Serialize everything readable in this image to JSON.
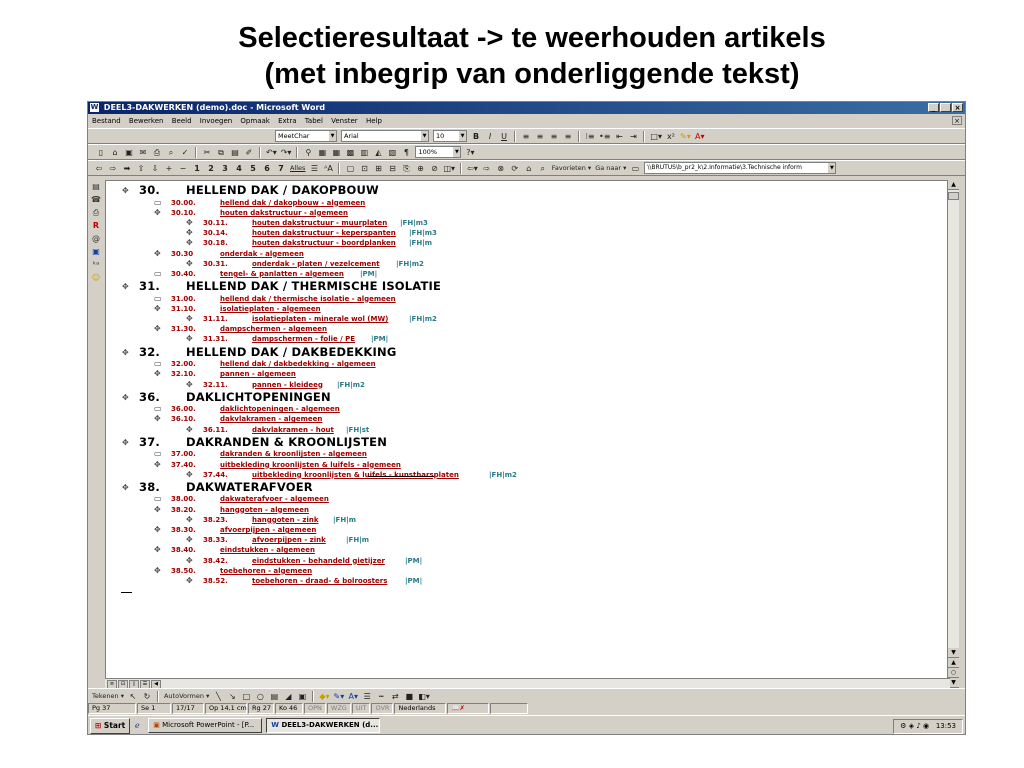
{
  "slide": {
    "title_line1": "Selectieresultaat -> te weerhouden artikels",
    "title_line2": "(met inbegrip van onderliggende tekst)"
  },
  "window": {
    "title": "DEEL3-DAKWERKEN (demo).doc - Microsoft Word",
    "minimize": "_",
    "restore": " ",
    "close": "×"
  },
  "menu": {
    "items": [
      "Bestand",
      "Bewerken",
      "Beeld",
      "Invoegen",
      "Opmaak",
      "Extra",
      "Tabel",
      "Venster",
      "Help"
    ],
    "doc_close": "×"
  },
  "format_toolbar": {
    "style": "MeetChar",
    "font": "Arial",
    "size": "10"
  },
  "standard_toolbar": {
    "zoom": "100%"
  },
  "outline_toolbar": {
    "levels": [
      "1",
      "2",
      "3",
      "4",
      "5",
      "6",
      "7"
    ],
    "all_label": "Alles",
    "favorites": "Favorieten",
    "goto": "Ga naar",
    "address": "\\\\BRUTUS\\b_pr2_k\\2.Informatie\\3.Technische inform"
  },
  "outline": [
    {
      "level": 1,
      "num": "30.",
      "text": "HELLEND DAK / DAKOPBOUW"
    },
    {
      "level": 2,
      "num": "30.00.",
      "text": "hellend dak / dakopbouw - algemeen"
    },
    {
      "level": 2,
      "num": "30.10.",
      "text": "houten dakstructuur - algemeen"
    },
    {
      "level": 3,
      "num": "30.11.",
      "text": "houten dakstructuur - muurplaten",
      "code": "|FH|m3"
    },
    {
      "level": 3,
      "num": "30.14.",
      "text": "houten dakstructuur - keperspanten",
      "code": "|FH|m3"
    },
    {
      "level": 3,
      "num": "30.18.",
      "text": "houten dakstructuur - boordplanken",
      "code": "|FH|m"
    },
    {
      "level": 2,
      "num": "30.30",
      "text": "onderdak - algemeen"
    },
    {
      "level": 3,
      "num": "30.31.",
      "text": "onderdak - platen / vezelcement",
      "code": "|FH|m2"
    },
    {
      "level": 2,
      "num": "30.40.",
      "text": "tengel- & panlatten - algemeen",
      "code": "|PM|"
    },
    {
      "level": 1,
      "num": "31.",
      "text": "HELLEND DAK / THERMISCHE ISOLATIE"
    },
    {
      "level": 2,
      "num": "31.00.",
      "text": "hellend dak / thermische isolatie - algemeen"
    },
    {
      "level": 2,
      "num": "31.10.",
      "text": "isolatieplaten - algemeen"
    },
    {
      "level": 3,
      "num": "31.11.",
      "text": "isolatieplaten - minerale wol (MW)",
      "code": "|FH|m2"
    },
    {
      "level": 2,
      "num": "31.30.",
      "text": "dampschermen - algemeen"
    },
    {
      "level": 3,
      "num": "31.31.",
      "text": "dampschermen - folie / PE",
      "code": "|PM|"
    },
    {
      "level": 1,
      "num": "32.",
      "text": "HELLEND DAK / DAKBEDEKKING"
    },
    {
      "level": 2,
      "num": "32.00.",
      "text": "hellend dak / dakbedekking - algemeen"
    },
    {
      "level": 2,
      "num": "32.10.",
      "text": "pannen - algemeen"
    },
    {
      "level": 3,
      "num": "32.11.",
      "text": "pannen - kleideeg",
      "code": "|FH|m2"
    },
    {
      "level": 1,
      "num": "36.",
      "text": "DAKLICHTOPENINGEN"
    },
    {
      "level": 2,
      "num": "36.00.",
      "text": "daklichtopeningen - algemeen"
    },
    {
      "level": 2,
      "num": "36.10.",
      "text": "dakvlakramen - algemeen"
    },
    {
      "level": 3,
      "num": "36.11.",
      "text": "dakvlakramen - hout",
      "code": "|FH|st"
    },
    {
      "level": 1,
      "num": "37.",
      "text": "DAKRANDEN & KROONLIJSTEN"
    },
    {
      "level": 2,
      "num": "37.00.",
      "text": "dakranden & kroonlijsten - algemeen"
    },
    {
      "level": 2,
      "num": "37.40.",
      "text": "uitbekleding kroonlijsten & luifels - algemeen"
    },
    {
      "level": 3,
      "num": "37.44.",
      "text": "uitbekleding kroonlijsten & luifels - kunstharsplaten",
      "code": "|FH|m2"
    },
    {
      "level": 1,
      "num": "38.",
      "text": "DAKWATERAFVOER"
    },
    {
      "level": 2,
      "num": "38.00.",
      "text": "dakwaterafvoer - algemeen"
    },
    {
      "level": 2,
      "num": "38.20.",
      "text": "hanggoten - algemeen"
    },
    {
      "level": 3,
      "num": "38.23.",
      "text": "hanggoten - zink",
      "code": "|FH|m"
    },
    {
      "level": 2,
      "num": "38.30.",
      "text": "afvoerpijpen - algemeen"
    },
    {
      "level": 3,
      "num": "38.33.",
      "text": "afvoerpijpen - zink",
      "code": "|FH|m"
    },
    {
      "level": 2,
      "num": "38.40.",
      "text": "eindstukken - algemeen"
    },
    {
      "level": 3,
      "num": "38.42.",
      "text": "eindstukken - behandeld gietijzer",
      "code": "|PM|"
    },
    {
      "level": 2,
      "num": "38.50.",
      "text": "toebehoren - algemeen"
    },
    {
      "level": 3,
      "num": "38.52.",
      "text": "toebehoren - draad- & bolroosters",
      "code": "|PM|"
    }
  ],
  "drawing_toolbar": {
    "draw": "Tekenen",
    "autoshapes": "AutoVormen"
  },
  "status": {
    "page": "Pg 37",
    "section": "Se 1",
    "pages": "17/17",
    "position": "Op 14,1 cm",
    "line": "Rg 27",
    "column": "Ko 46",
    "opn": "OPN",
    "wzg": "WZG",
    "uit": "UIT",
    "ovr": "OVR",
    "language": "Nederlands"
  },
  "taskbar": {
    "start": "Start",
    "tasks": [
      "Microsoft PowerPoint - [P...",
      "DEEL3-DAKWERKEN (d..."
    ],
    "clock": "13:53"
  }
}
